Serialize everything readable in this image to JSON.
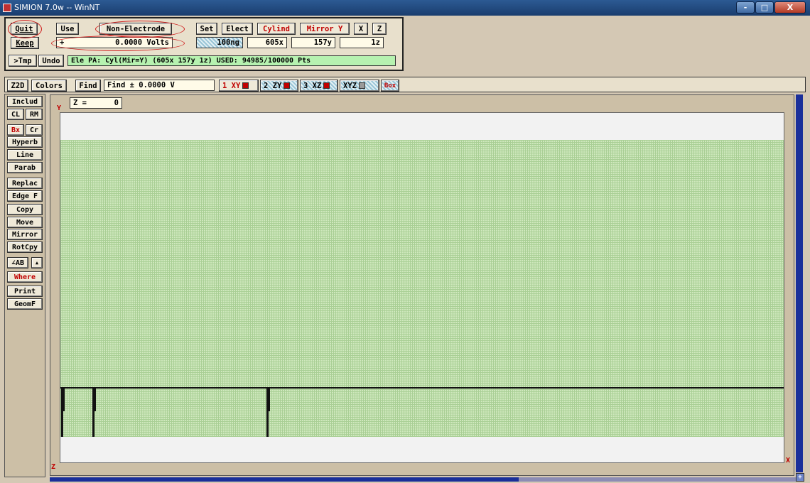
{
  "window": {
    "title": "SIMION 7.0w -- WinNT",
    "buttons": [
      "-",
      "□",
      "X"
    ]
  },
  "toolbar_left": {
    "quit": "Quit",
    "keep": "Keep",
    "use": "Use",
    "electrode_mode": "Non-Electrode",
    "sign": "+",
    "volts": "0.0000 Volts",
    "tmp": ">Tmp",
    "undo": "Undo",
    "status": "Ele PA: Cyl(Mir=Y) (605x 157y 1z)  USED: 94985/100000 Pts"
  },
  "toolbar_right": {
    "set": "Set",
    "elect": "Elect",
    "cylind": "Cylind",
    "mirror_y": "Mirror Y",
    "x": "X",
    "z": "Z",
    "ng": "100ng",
    "nx": "605x",
    "ny": "157y",
    "nz": "1z"
  },
  "view_toolbar": {
    "z2d": "Z2D",
    "colors": "Colors",
    "find": "Find",
    "find_field": "Find ±         0.0000 V",
    "views": [
      "1 XY",
      "2 ZY",
      "3 XZ",
      "XYZ",
      "Box"
    ]
  },
  "sidebar": {
    "includ": "Includ",
    "cl": "CL",
    "rm": "RM",
    "bx": "Bx",
    "cr": "Cr",
    "hyperb": "Hyperb",
    "line": "Line",
    "parab": "Parab",
    "replac": "Replac",
    "edgef": "Edge F",
    "copy": "Copy",
    "move": "Move",
    "mirror": "Mirror",
    "rotcpy": "RotCpy",
    "ab": "∠AB",
    "up": "▲",
    "where": "Where",
    "print": "Print",
    "geomf": "GeomF"
  },
  "view": {
    "z_label": "Z =",
    "z_value": "0",
    "axis_y": "Y",
    "axis_x": "X",
    "axis_z": "Z"
  },
  "colors": {
    "accent_red": "#c00000",
    "grid_green": "#cfe8bd",
    "scroll_blue": "#1a2f9a"
  }
}
